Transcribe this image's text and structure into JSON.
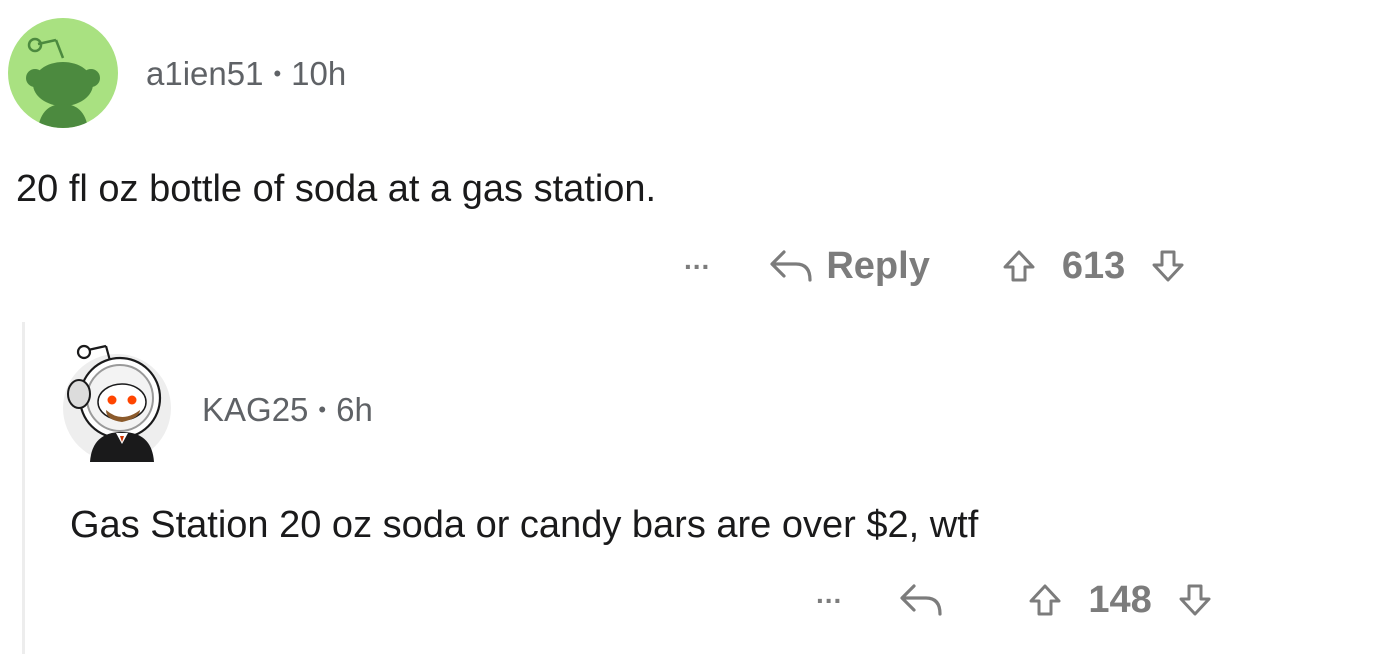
{
  "comments": [
    {
      "username": "a1ien51",
      "separator": "•",
      "age": "10h",
      "body": "20 fl oz bottle of soda at a gas station.",
      "more_label": "...",
      "reply_label": "Reply",
      "score": "613",
      "avatar_icon": "snoo-avatar-green-icon"
    },
    {
      "username": "KAG25",
      "separator": "•",
      "age": "6h",
      "body": "Gas Station 20 oz soda or candy bars are over $2, wtf",
      "more_label": "...",
      "score": "148",
      "avatar_icon": "snoo-astronaut-avatar-icon"
    }
  ],
  "colors": {
    "avatar_green": "#a9e181",
    "snoo_dark_green": "#4c8a3f",
    "meta_text": "#5f6266",
    "action_text": "#7c7c7c",
    "thread_line": "#ededed"
  }
}
